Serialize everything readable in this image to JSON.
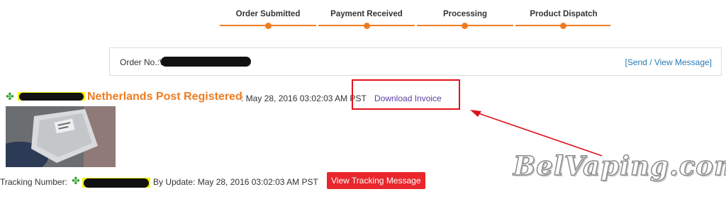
{
  "steps": [
    {
      "label": "Order Submitted"
    },
    {
      "label": "Payment Received"
    },
    {
      "label": "Processing"
    },
    {
      "label": "Product Dispatch"
    }
  ],
  "order": {
    "label": "Order No.:W",
    "message_link": "[Send / View Message]"
  },
  "shipment": {
    "carrier": "Netherlands Post Registered",
    "date_text": ": May 28, 2016 03:02:03 AM PST",
    "invoice_link": "Download Invoice"
  },
  "tracking": {
    "label": "Tracking Number:",
    "update_text": "By Update: May 28, 2016 03:02:03 AM PST",
    "button": "View Tracking Message"
  },
  "watermark": {
    "text": "BelVaping.com"
  },
  "colors": {
    "accent": "#f07c1e",
    "link_blue": "#2a7ab5",
    "button_red": "#e8262b",
    "annotation_red": "#e0131a",
    "highlight_yellow": "#f6f20a"
  }
}
